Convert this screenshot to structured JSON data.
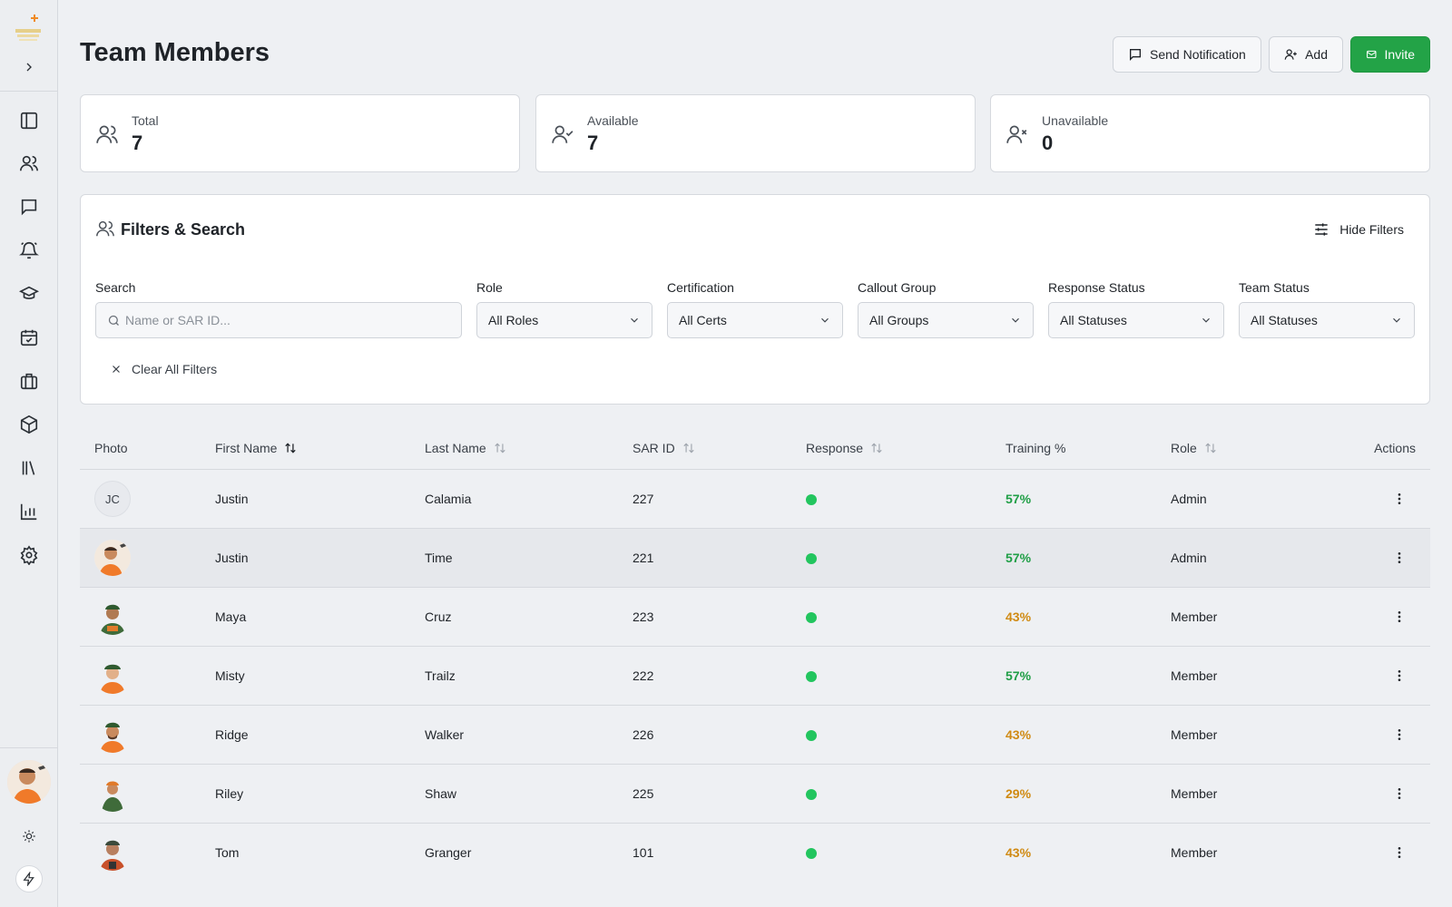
{
  "header": {
    "title": "Team Members",
    "buttons": {
      "send_notification": "Send Notification",
      "add": "Add",
      "invite": "Invite"
    }
  },
  "stats": [
    {
      "label": "Total",
      "value": "7"
    },
    {
      "label": "Available",
      "value": "7"
    },
    {
      "label": "Unavailable",
      "value": "0"
    }
  ],
  "filters": {
    "title": "Filters & Search",
    "hide_label": "Hide Filters",
    "search_label": "Search",
    "search_placeholder": "Name or SAR ID...",
    "role_label": "Role",
    "role_value": "All Roles",
    "cert_label": "Certification",
    "cert_value": "All Certs",
    "group_label": "Callout Group",
    "group_value": "All Groups",
    "response_label": "Response Status",
    "response_value": "All Statuses",
    "team_label": "Team Status",
    "team_value": "All Statuses",
    "clear_label": "Clear All Filters"
  },
  "table": {
    "columns": {
      "photo": "Photo",
      "first": "First Name",
      "last": "Last Name",
      "sar": "SAR ID",
      "response": "Response",
      "training": "Training %",
      "role": "Role",
      "actions": "Actions"
    },
    "rows": [
      {
        "initials": "JC",
        "first": "Justin",
        "last": "Calamia",
        "sar": "227",
        "training": "57%",
        "role": "Admin"
      },
      {
        "first": "Justin",
        "last": "Time",
        "sar": "221",
        "training": "57%",
        "role": "Admin"
      },
      {
        "first": "Maya",
        "last": "Cruz",
        "sar": "223",
        "training": "43%",
        "role": "Member"
      },
      {
        "first": "Misty",
        "last": "Trailz",
        "sar": "222",
        "training": "57%",
        "role": "Member"
      },
      {
        "first": "Ridge",
        "last": "Walker",
        "sar": "226",
        "training": "43%",
        "role": "Member"
      },
      {
        "first": "Riley",
        "last": "Shaw",
        "sar": "225",
        "training": "29%",
        "role": "Member"
      },
      {
        "first": "Tom",
        "last": "Granger",
        "sar": "101",
        "training": "43%",
        "role": "Member"
      }
    ]
  },
  "colors": {
    "accent_green": "#23a347",
    "pct_green": "#1e9e45",
    "pct_amber": "#d08a12",
    "status_dot": "#22c55e"
  }
}
